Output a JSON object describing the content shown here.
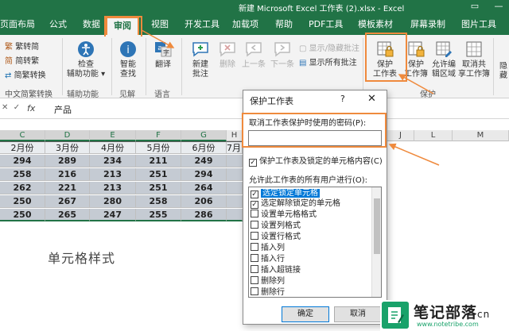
{
  "window": {
    "title": "新建 Microsoft Excel 工作表 (2).xlsx - Excel"
  },
  "tabs": [
    "页面布局",
    "公式",
    "数据",
    "审阅",
    "视图",
    "开发工具",
    "加载项",
    "帮助",
    "PDF工具",
    "模板素材",
    "屏幕录制",
    "图片工具"
  ],
  "active_tab": "审阅",
  "ribbon": {
    "chinese_convert": {
      "items": [
        "繁转简",
        "简转繁",
        "简繁转换"
      ],
      "group": "中文简繁转换"
    },
    "accessibility": {
      "label1": "检查",
      "label2": "辅助功能",
      "group": "辅助功能"
    },
    "insights": {
      "label1": "智能",
      "label2": "查找",
      "group": "见解"
    },
    "language": {
      "label": "翻译",
      "group": "语言"
    },
    "comments": {
      "new1": "新建",
      "new2": "批注",
      "delete": "删除",
      "prev": "上一条",
      "next": "下一条",
      "show_hide": "显示/隐藏批注",
      "show_all": "显示所有批注"
    },
    "protect": {
      "sheet1": "保护",
      "sheet2": "工作表",
      "workbook1": "保护",
      "workbook2": "工作簿",
      "allow1": "允许编",
      "allow2": "辑区域",
      "unshare1": "取消共",
      "unshare2": "享工作簿",
      "group": "保护"
    },
    "hide_partial": "隐藏"
  },
  "formula_bar": {
    "fx": "fx",
    "content": "产品"
  },
  "columns": [
    "C",
    "D",
    "E",
    "F",
    "G",
    "H",
    "I",
    "J",
    "K",
    "L",
    "M"
  ],
  "table": {
    "headers": [
      "2月份",
      "3月份",
      "4月份",
      "5月份",
      "6月份",
      "7月"
    ],
    "rows": [
      [
        "294",
        "289",
        "234",
        "211",
        "249",
        ""
      ],
      [
        "258",
        "216",
        "213",
        "251",
        "294",
        ""
      ],
      [
        "262",
        "221",
        "213",
        "251",
        "264",
        ""
      ],
      [
        "250",
        "267",
        "280",
        "258",
        "206",
        ""
      ],
      [
        "250",
        "265",
        "247",
        "255",
        "286",
        ""
      ]
    ]
  },
  "sheet_text": "单元格样式",
  "dialog": {
    "title": "保护工作表",
    "help": "?",
    "close": "✕",
    "password_label": "取消工作表保护时使用的密码(P):",
    "password_value": "",
    "protect_check_label": "保护工作表及锁定的单元格内容(C)",
    "permissions_label": "允许此工作表的所有用户进行(O):",
    "permissions": [
      {
        "label": "选定锁定单元格",
        "checked": true
      },
      {
        "label": "选定解除锁定的单元格",
        "checked": true
      },
      {
        "label": "设置单元格格式",
        "checked": false
      },
      {
        "label": "设置列格式",
        "checked": false
      },
      {
        "label": "设置行格式",
        "checked": false
      },
      {
        "label": "插入列",
        "checked": false
      },
      {
        "label": "插入行",
        "checked": false
      },
      {
        "label": "插入超链接",
        "checked": false
      },
      {
        "label": "删除列",
        "checked": false
      },
      {
        "label": "删除行",
        "checked": false
      }
    ],
    "ok": "确定",
    "cancel": "取消"
  },
  "watermark": {
    "name": "笔记部落",
    "suffix": "cn",
    "url": "www.notetribe.com"
  },
  "colors": {
    "excel_green": "#217346",
    "highlight_orange": "#ef8a3d",
    "selection_blue": "#0078d7"
  }
}
